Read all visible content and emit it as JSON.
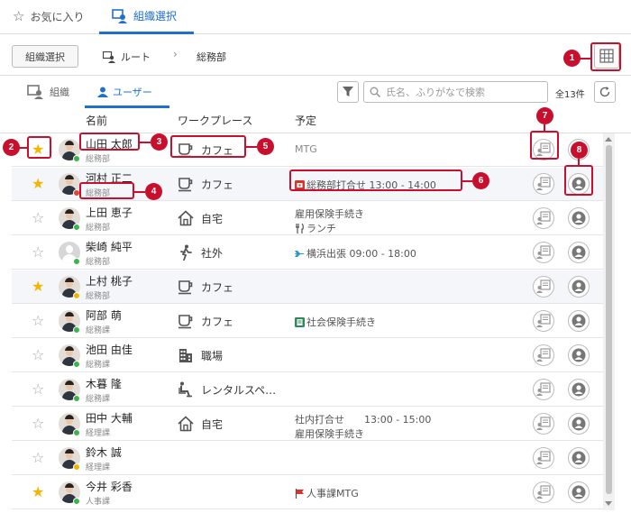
{
  "top_tabs": {
    "favorites": "お気に入り",
    "org_select": "組織選択"
  },
  "toolbar": {
    "org_select_button": "組織選択",
    "breadcrumb_root": "ルート",
    "breadcrumb_separator": "›",
    "breadcrumb_current": "総務部"
  },
  "subtabs": {
    "org": "組織",
    "user": "ユーザー"
  },
  "search": {
    "placeholder": "氏名、ふりがなで検索",
    "value": ""
  },
  "count": "全13件",
  "columns": {
    "name": "名前",
    "workplace": "ワークプレース",
    "schedule": "予定"
  },
  "colors": {
    "accent": "#1f6fcf",
    "star_on": "#f5b400",
    "callout": "#c8102e",
    "status_online": "#3bb54a",
    "status_busy": "#e0453a",
    "status_away": "#f0b400"
  },
  "users": [
    {
      "name": "山田 太郎",
      "dept": "総務部",
      "starred": true,
      "status": "online",
      "avatar": "photo",
      "workplace": "カフェ",
      "workplace_icon": "cafe-icon",
      "schedule": [
        {
          "text": "MTG",
          "icon": "",
          "gray": true
        }
      ]
    },
    {
      "name": "河村 正二",
      "dept": "総務部",
      "starred": true,
      "status": "busy",
      "avatar": "photo",
      "workplace": "カフェ",
      "workplace_icon": "cafe-icon",
      "schedule": [
        {
          "text": "総務部打合せ 13:00 - 14:00",
          "icon": "meeting-icon",
          "gray": false
        }
      ]
    },
    {
      "name": "上田 恵子",
      "dept": "総務部",
      "starred": false,
      "status": "online",
      "avatar": "photo",
      "workplace": "自宅",
      "workplace_icon": "home-icon",
      "schedule": [
        {
          "text": "雇用保険手続き",
          "icon": "",
          "gray": false
        },
        {
          "text": "ランチ",
          "icon": "lunch-icon",
          "gray": false
        }
      ]
    },
    {
      "name": "柴崎 純平",
      "dept": "総務部",
      "starred": false,
      "status": "online",
      "avatar": "gray",
      "workplace": "社外",
      "workplace_icon": "walking-icon",
      "schedule": [
        {
          "text": "横浜出張 09:00 - 18:00",
          "icon": "airplane-icon",
          "gray": false
        }
      ]
    },
    {
      "name": "上村 桃子",
      "dept": "総務部",
      "starred": true,
      "status": "away",
      "avatar": "photo",
      "workplace": "カフェ",
      "workplace_icon": "cafe-icon",
      "schedule": []
    },
    {
      "name": "阿部 萌",
      "dept": "総務課",
      "starred": false,
      "status": "online",
      "avatar": "photo",
      "workplace": "カフェ",
      "workplace_icon": "cafe-icon",
      "schedule": [
        {
          "text": "社会保険手続き",
          "icon": "document-icon",
          "gray": false
        }
      ]
    },
    {
      "name": "池田 由佳",
      "dept": "総務課",
      "starred": false,
      "status": "online",
      "avatar": "photo",
      "workplace": "職場",
      "workplace_icon": "office-icon",
      "schedule": []
    },
    {
      "name": "木暮 隆",
      "dept": "総務課",
      "starred": false,
      "status": "online",
      "avatar": "photo",
      "workplace": "レンタルスペ…",
      "workplace_icon": "seat-icon",
      "schedule": []
    },
    {
      "name": "田中 大輔",
      "dept": "経理課",
      "starred": false,
      "status": "online",
      "avatar": "photo",
      "workplace": "自宅",
      "workplace_icon": "home-icon",
      "schedule": [
        {
          "text": "社内打合せ　　13:00 - 15:00",
          "icon": "",
          "gray": false
        },
        {
          "text": "雇用保険手続き",
          "icon": "",
          "gray": false
        }
      ]
    },
    {
      "name": "鈴木 誠",
      "dept": "経理課",
      "starred": false,
      "status": "away",
      "avatar": "photo",
      "workplace": "",
      "workplace_icon": "",
      "schedule": []
    },
    {
      "name": "今井 彩香",
      "dept": "人事課",
      "starred": true,
      "status": "online",
      "avatar": "photo",
      "workplace": "",
      "workplace_icon": "",
      "schedule": [
        {
          "text": "人事課MTG",
          "icon": "flag-icon",
          "gray": false
        }
      ]
    }
  ],
  "callouts": [
    "1",
    "2",
    "3",
    "4",
    "5",
    "6",
    "7",
    "8"
  ]
}
